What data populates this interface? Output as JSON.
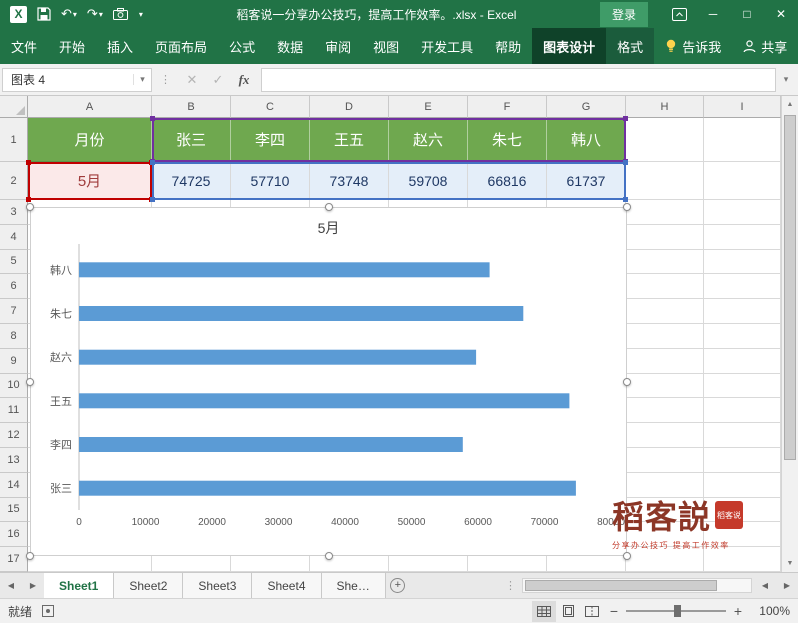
{
  "titlebar": {
    "title": "稻客说一分享办公技巧，提高工作效率。.xlsx  -  Excel",
    "sign_in_label": "登录"
  },
  "ribbon": {
    "tabs": [
      {
        "label": "文件"
      },
      {
        "label": "开始"
      },
      {
        "label": "插入"
      },
      {
        "label": "页面布局"
      },
      {
        "label": "公式"
      },
      {
        "label": "数据"
      },
      {
        "label": "审阅"
      },
      {
        "label": "视图"
      },
      {
        "label": "开发工具"
      },
      {
        "label": "帮助"
      },
      {
        "label": "图表设计",
        "contextual": true,
        "active": true
      },
      {
        "label": "格式",
        "contextual": true
      }
    ],
    "tell_me_label": "告诉我",
    "share_label": "共享"
  },
  "formula_bar": {
    "name_box": "图表 4",
    "cancel": "✕",
    "enter": "✓",
    "fx_label": "fx",
    "formula_value": ""
  },
  "sheet": {
    "columns": [
      "A",
      "B",
      "C",
      "D",
      "E",
      "F",
      "G",
      "H",
      "I"
    ],
    "row_numbers": [
      "1",
      "2",
      "3",
      "4",
      "5",
      "6",
      "7",
      "8",
      "9",
      "10",
      "11",
      "12",
      "13",
      "14",
      "15",
      "16",
      "17"
    ],
    "header_row": [
      "月份",
      "张三",
      "李四",
      "王五",
      "赵六",
      "朱七",
      "韩八"
    ],
    "category_cell": "5月",
    "value_cells": [
      "74725",
      "57710",
      "73748",
      "59708",
      "66816",
      "61737"
    ]
  },
  "chart_data": {
    "type": "bar",
    "orientation": "horizontal",
    "title": "5月",
    "categories": [
      "张三",
      "李四",
      "王五",
      "赵六",
      "朱七",
      "韩八"
    ],
    "values": [
      74725,
      57710,
      73748,
      59708,
      66816,
      61737
    ],
    "display_order_top_to_bottom": [
      "韩八",
      "朱七",
      "赵六",
      "王五",
      "李四",
      "张三"
    ],
    "xlim": [
      0,
      80000
    ],
    "xticks": [
      0,
      10000,
      20000,
      30000,
      40000,
      50000,
      60000,
      70000,
      80000
    ],
    "bar_color": "#5B9BD5",
    "legend": "none",
    "gridlines": false
  },
  "sheet_tabs": {
    "tabs": [
      "Sheet1",
      "Sheet2",
      "Sheet3",
      "Sheet4",
      "She…"
    ]
  },
  "status_bar": {
    "ready_label": "就绪",
    "zoom_label": "100%"
  },
  "watermark": {
    "brand": "稻客説",
    "seal_text": "稻客说",
    "caption": "分享办公技巧 提高工作效率"
  },
  "colors": {
    "titlebar_green": "#217346",
    "header_fill": "#6FA84F",
    "bar_blue": "#5B9BD5",
    "value_fill": "#E4EEF9",
    "category_fill": "#FBE9E9",
    "series_names_outline": "#7030A0",
    "values_outline": "#4472C4",
    "category_outline": "#C00000"
  },
  "icons": {
    "undo": "↶",
    "redo": "↷",
    "caret_down": "▾",
    "minimize": "─",
    "maximize": "□",
    "close": "✕",
    "splitter": "⋮",
    "scroll_up": "▲",
    "scroll_down": "▼",
    "tab_prev": "◀",
    "tab_next": "▶",
    "zoom_out": "−",
    "zoom_in": "+",
    "add_sheet": "+"
  }
}
